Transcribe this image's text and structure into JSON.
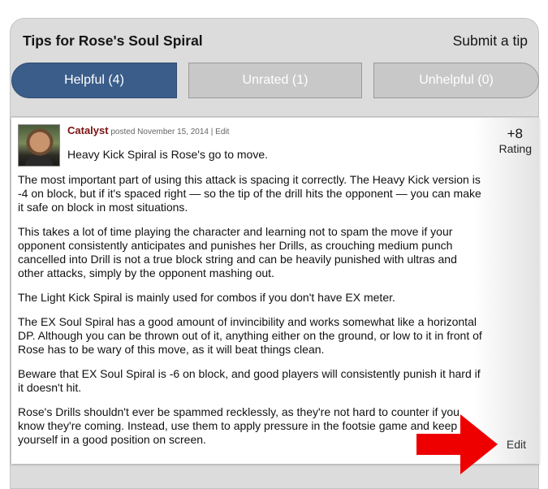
{
  "header": {
    "title": "Tips for Rose's Soul Spiral",
    "submit_label": "Submit a tip"
  },
  "tabs": [
    {
      "label": "Helpful (4)",
      "active": true
    },
    {
      "label": "Unrated (1)",
      "active": false
    },
    {
      "label": "Unhelpful (0)",
      "active": false
    }
  ],
  "tip": {
    "author": "Catalyst",
    "posted": "posted November 15, 2014 |",
    "edit_small": "Edit",
    "summary": "Heavy Kick Spiral is Rose's go to move.",
    "paragraphs": [
      "The most important part of using this attack is spacing it correctly. The Heavy Kick version is -4 on block, but if it's spaced right — so the tip of the drill hits the opponent — you can make it safe on block in most situations.",
      "This takes a lot of time playing the character and learning not to spam the move if your opponent consistently anticipates and punishes her Drills, as crouching medium punch cancelled into Drill is not a true block string and can be heavily punished with ultras and other attacks, simply by the opponent mashing out.",
      "The Light Kick Spiral is mainly used for combos if you don't have EX meter.",
      "The EX Soul Spiral has a good amount of invincibility and works somewhat like a horizontal DP. Although you can be thrown out of it, anything either on the ground, or low to it in front of Rose has to be wary of this move, as it will beat things clean.",
      "Beware that EX Soul Spiral is -6 on block, and good players will consistently punish it hard if it doesn't hit.",
      "Rose's Drills shouldn't ever be spammed recklessly, as they're not hard to counter if you know they're coming. Instead, use them to apply pressure in the footsie game and keep yourself in a good position on screen."
    ],
    "rating_value": "+8",
    "rating_label": "Rating",
    "edit_label": "Edit"
  },
  "colors": {
    "active_tab": "#3b5d8a",
    "inactive_tab": "#c8c8c8",
    "author": "#7a1111",
    "arrow": "#ee0000"
  },
  "icons": {
    "pointer": "red-arrow-icon"
  }
}
